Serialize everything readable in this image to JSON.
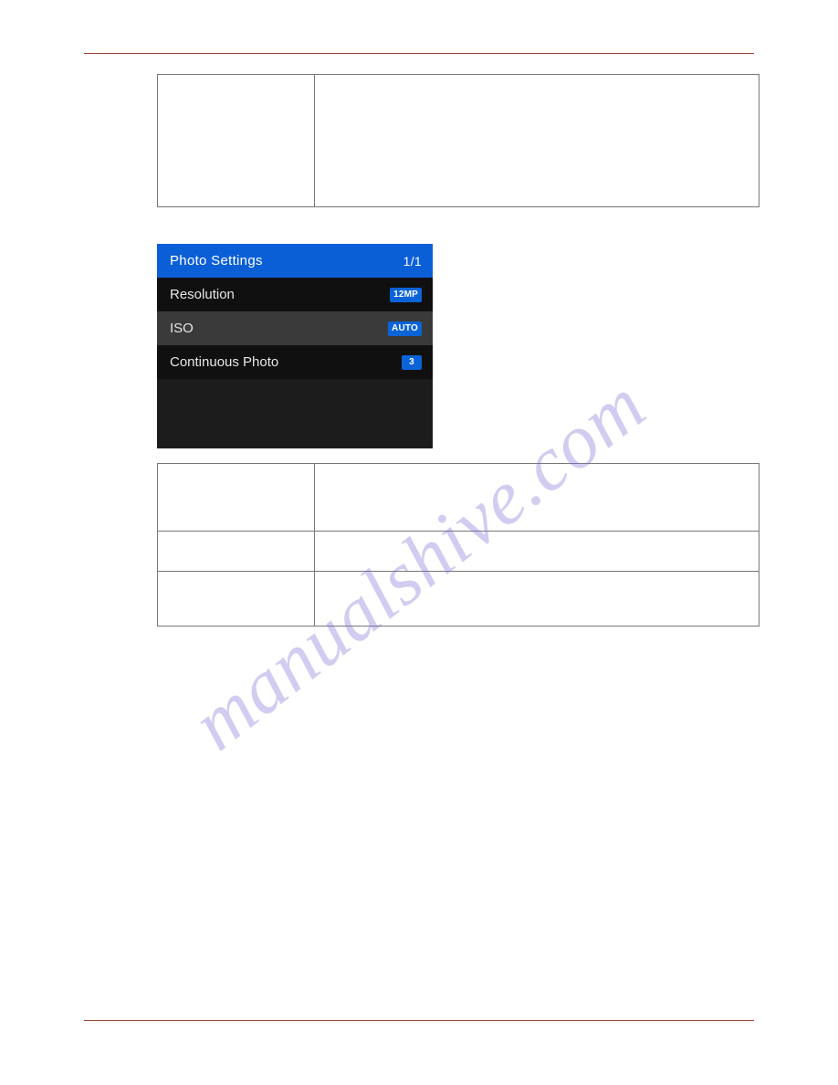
{
  "watermark": "manualshive.com",
  "screen": {
    "title": "Photo Settings",
    "page": "1/1",
    "rows": [
      {
        "label": "Resolution",
        "badge": "12MP"
      },
      {
        "label": "ISO",
        "badge": "AUTO"
      },
      {
        "label": "Continuous Photo",
        "badge": "3"
      }
    ]
  }
}
